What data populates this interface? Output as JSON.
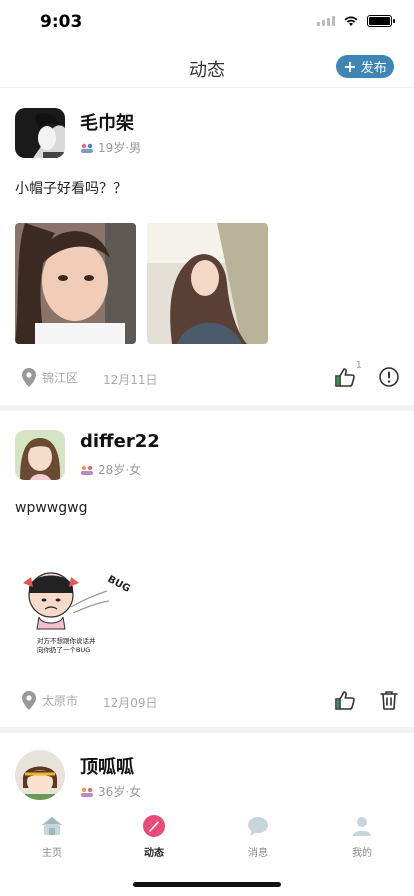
{
  "status": {
    "time": "9:03"
  },
  "nav": {
    "title": "动态",
    "publish_label": "发布"
  },
  "posts": [
    {
      "username": "毛巾架",
      "age_gender": "19岁·男",
      "text": "小帽子好看吗？？",
      "location": "锦江区",
      "date": "12月11日",
      "like_count": "1",
      "right_action": "report-icon"
    },
    {
      "username": "differ22",
      "age_gender": "28岁·女",
      "text": "wpwwgwg",
      "meme_text": "BUG",
      "meme_caption1": "对方不想跟你说话并",
      "meme_caption2": "向你扔了一个BUG",
      "location": "太原市",
      "date": "12月09日",
      "right_action": "delete-icon"
    },
    {
      "username": "顶呱呱",
      "age_gender": "36岁·女"
    }
  ],
  "tabs": [
    {
      "label": "主页",
      "icon": "home-icon"
    },
    {
      "label": "动态",
      "icon": "feather-icon"
    },
    {
      "label": "消息",
      "icon": "chat-icon"
    },
    {
      "label": "我的",
      "icon": "user-icon"
    }
  ],
  "colors": {
    "accent": "#3f86b6",
    "active_tab": "#e84a7a"
  }
}
